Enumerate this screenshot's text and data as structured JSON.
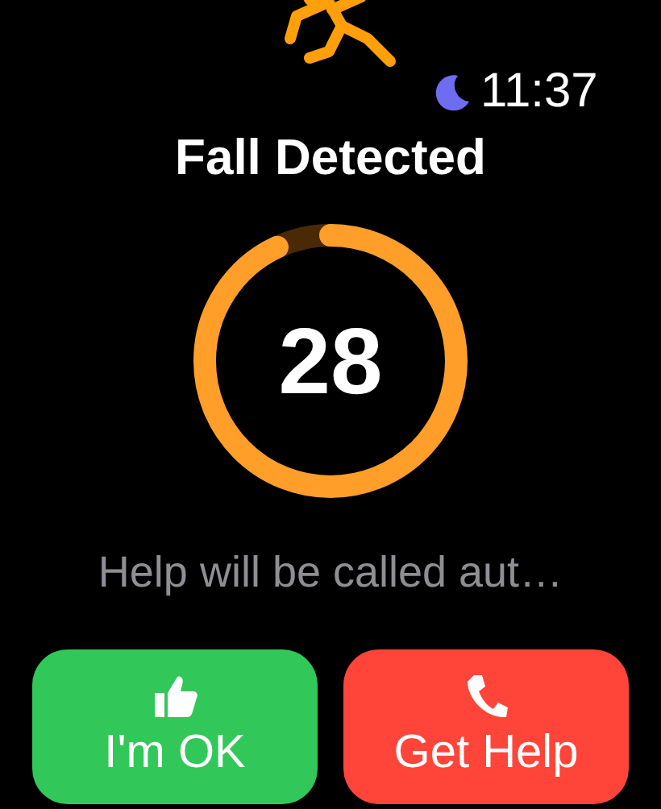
{
  "status": {
    "time": "11:37",
    "focus_on": true
  },
  "title": "Fall Detected",
  "countdown": {
    "value": "28"
  },
  "message": "Help will be called aut…",
  "buttons": [
    {
      "label": "I'm OK",
      "kind": "ok"
    },
    {
      "label": "Get Help",
      "kind": "help"
    }
  ]
}
